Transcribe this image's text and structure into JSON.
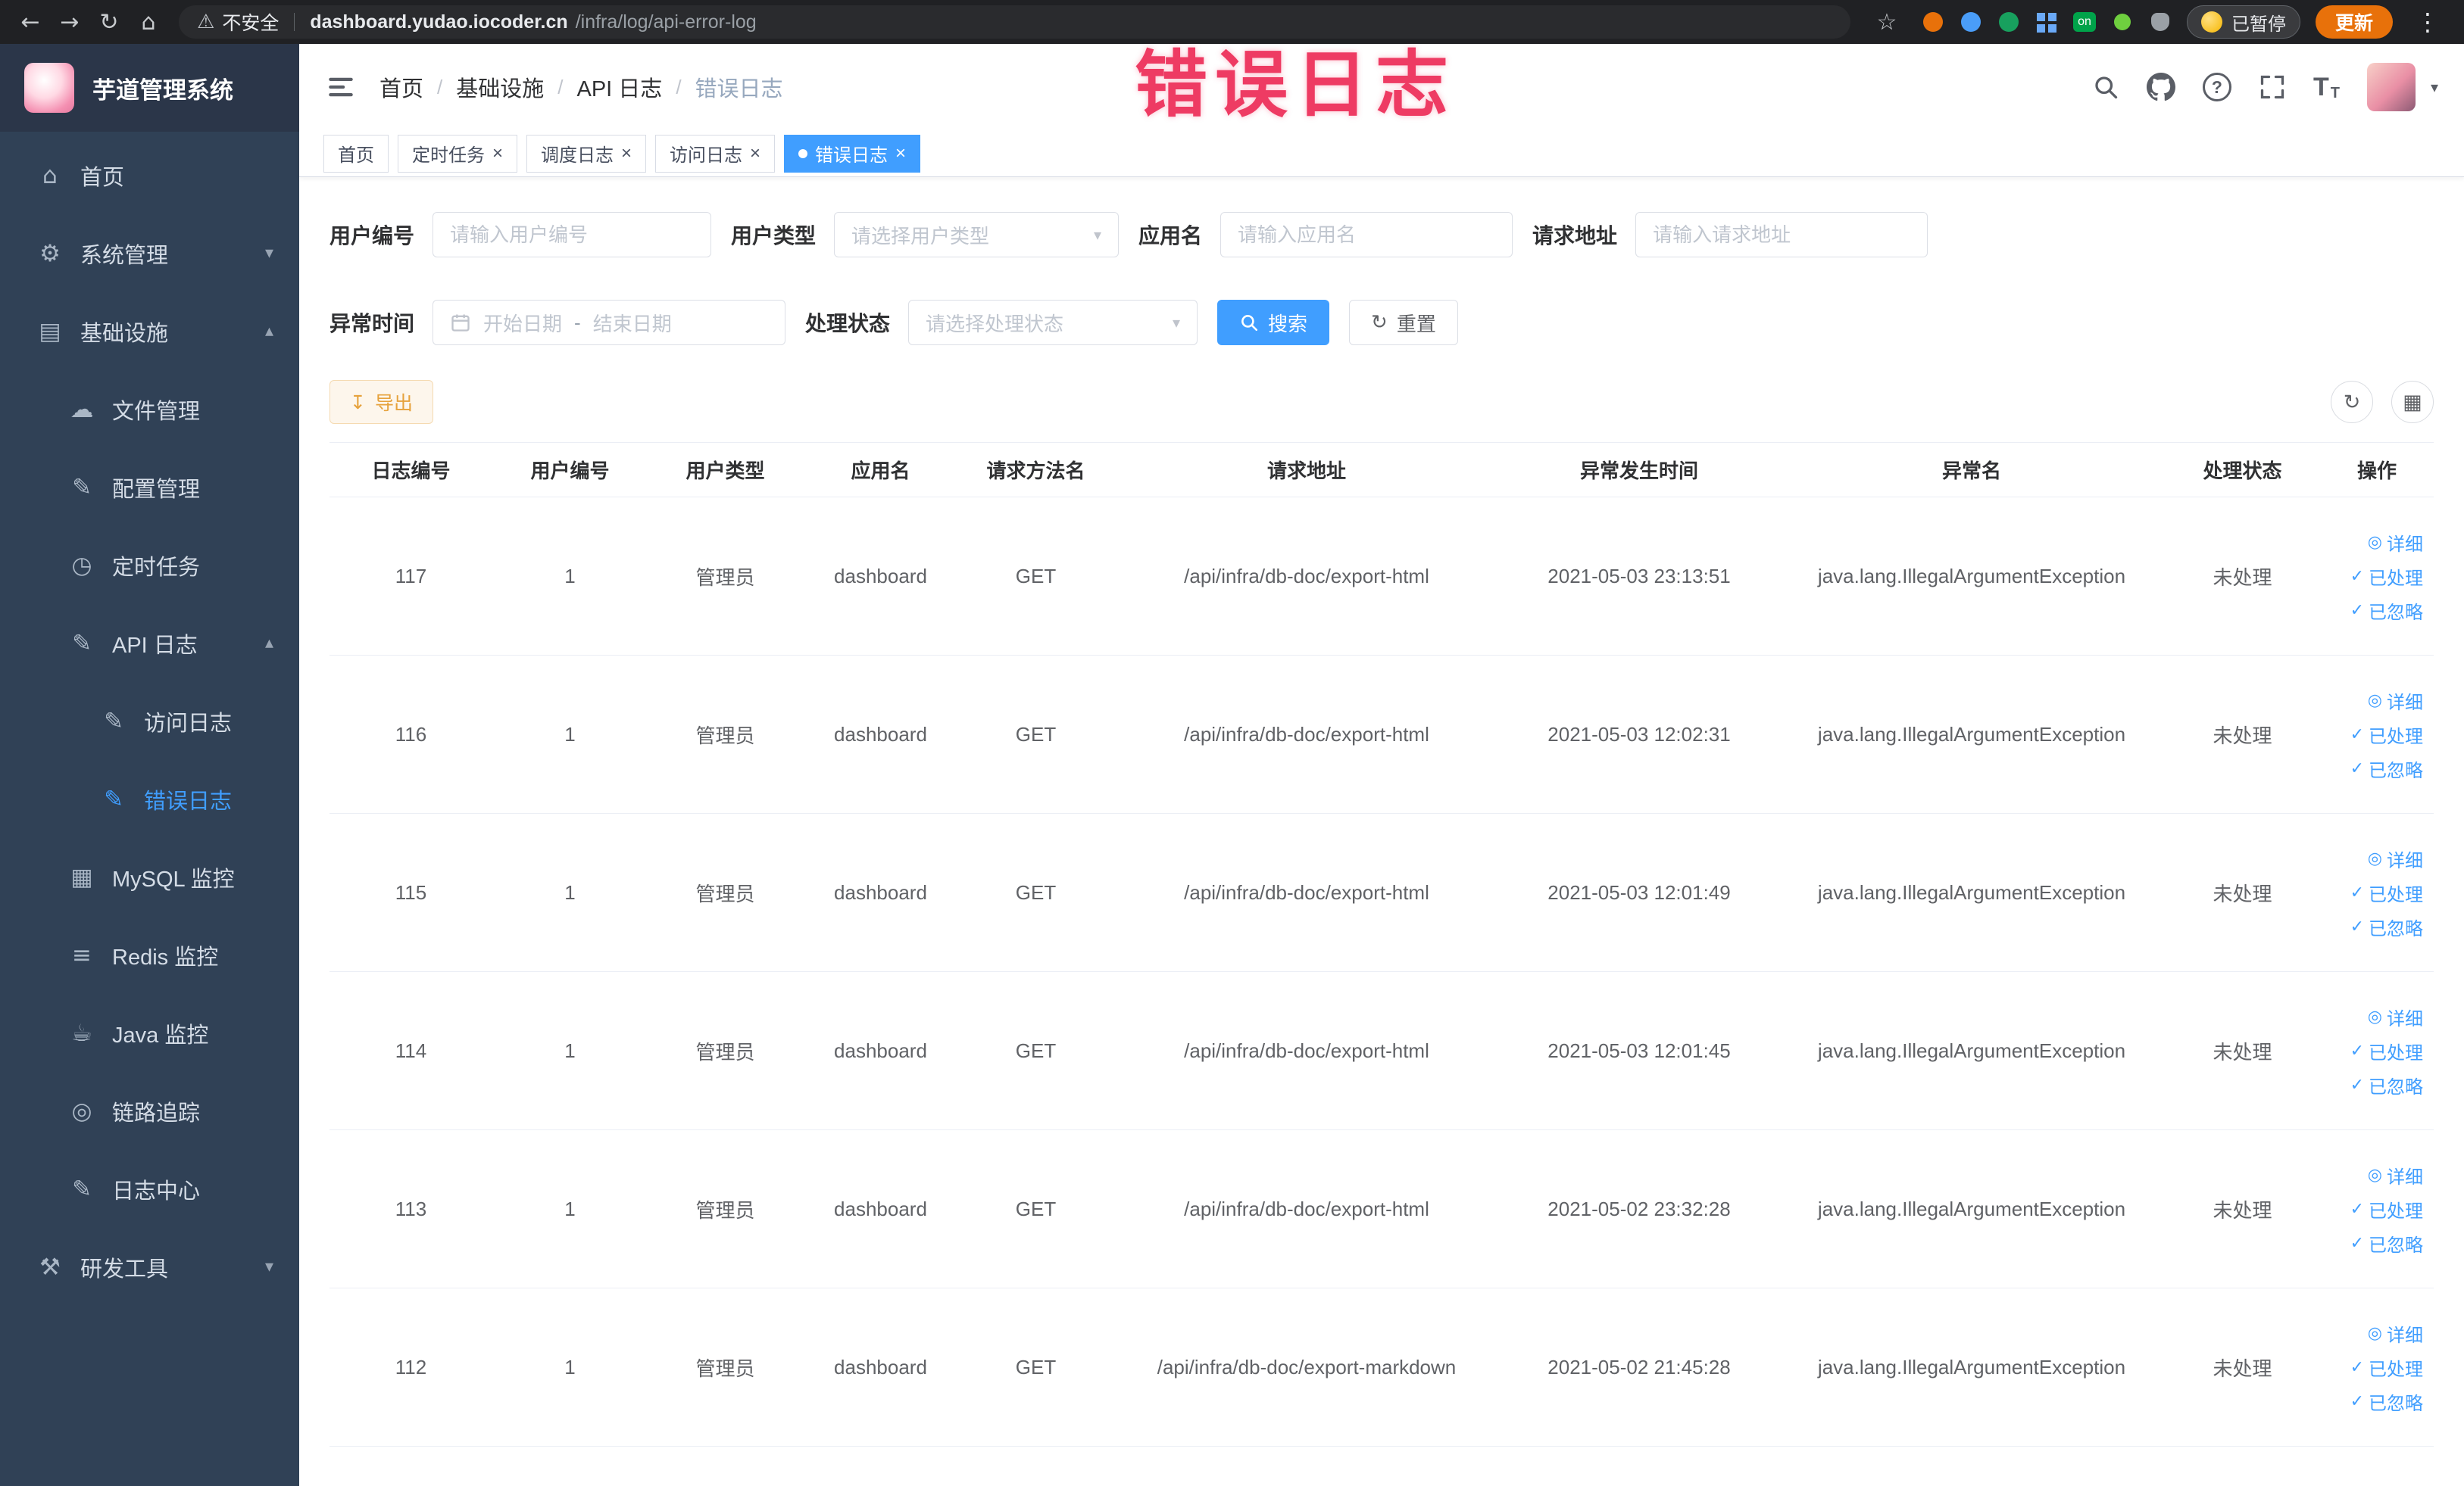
{
  "browser": {
    "security_label": "不安全",
    "url_host": "dashboard.yudao.iocoder.cn",
    "url_path": "/infra/log/api-error-log",
    "paused_label": "已暂停",
    "update_label": "更新"
  },
  "annotation": {
    "text": "错误日志"
  },
  "sidebar": {
    "logo_title": "芋道管理系统",
    "items": [
      {
        "icon": "home",
        "label": "首页",
        "level": 0
      },
      {
        "icon": "gear",
        "label": "系统管理",
        "level": 0,
        "chevron": "down"
      },
      {
        "icon": "monitor",
        "label": "基础设施",
        "level": 0,
        "chevron": "up"
      },
      {
        "icon": "cloud",
        "label": "文件管理",
        "level": 1
      },
      {
        "icon": "edit",
        "label": "配置管理",
        "level": 1
      },
      {
        "icon": "timer",
        "label": "定时任务",
        "level": 1
      },
      {
        "icon": "doc",
        "label": "API 日志",
        "level": 1,
        "chevron": "up"
      },
      {
        "icon": "doc",
        "label": "访问日志",
        "level": 2
      },
      {
        "icon": "doc",
        "label": "错误日志",
        "level": 2,
        "active": true
      },
      {
        "icon": "db",
        "label": "MySQL 监控",
        "level": 1
      },
      {
        "icon": "redis",
        "label": "Redis 监控",
        "level": 1
      },
      {
        "icon": "java",
        "label": "Java 监控",
        "level": 1
      },
      {
        "icon": "trace",
        "label": "链路追踪",
        "level": 1
      },
      {
        "icon": "log",
        "label": "日志中心",
        "level": 1
      },
      {
        "icon": "tools",
        "label": "研发工具",
        "level": 0,
        "chevron": "down"
      }
    ]
  },
  "breadcrumb": {
    "items": [
      {
        "label": "首页",
        "sep": "/"
      },
      {
        "label": "基础设施",
        "sep": "/"
      },
      {
        "label": "API 日志",
        "sep": "/"
      },
      {
        "label": "错误日志",
        "last": true
      }
    ]
  },
  "tabs": [
    {
      "label": "首页"
    },
    {
      "label": "定时任务",
      "closable": true
    },
    {
      "label": "调度日志",
      "closable": true
    },
    {
      "label": "访问日志",
      "closable": true
    },
    {
      "label": "错误日志",
      "closable": true,
      "active": true,
      "dot": true
    }
  ],
  "filters": {
    "user_id": {
      "label": "用户编号",
      "placeholder": "请输入用户编号"
    },
    "user_type": {
      "label": "用户类型",
      "placeholder": "请选择用户类型"
    },
    "app_name": {
      "label": "应用名",
      "placeholder": "请输入应用名"
    },
    "request_url": {
      "label": "请求地址",
      "placeholder": "请输入请求地址"
    },
    "exception_time": {
      "label": "异常时间",
      "start_placeholder": "开始日期",
      "separator": "-",
      "end_placeholder": "结束日期"
    },
    "process_status": {
      "label": "处理状态",
      "placeholder": "请选择处理状态"
    },
    "search_label": "搜索",
    "reset_label": "重置"
  },
  "toolbar": {
    "export_label": "导出"
  },
  "table": {
    "columns": [
      "日志编号",
      "用户编号",
      "用户类型",
      "应用名",
      "请求方法名",
      "请求地址",
      "异常发生时间",
      "异常名",
      "处理状态",
      "操作"
    ],
    "action_labels": {
      "detail": "详细",
      "processed": "已处理",
      "ignored": "已忽略"
    },
    "rows": [
      {
        "id": "117",
        "user_id": "1",
        "user_type": "管理员",
        "app": "dashboard",
        "method": "GET",
        "url": "/api/infra/db-doc/export-html",
        "time": "2021-05-03 23:13:51",
        "exception": "java.lang.IllegalArgumentException",
        "status": "未处理"
      },
      {
        "id": "116",
        "user_id": "1",
        "user_type": "管理员",
        "app": "dashboard",
        "method": "GET",
        "url": "/api/infra/db-doc/export-html",
        "time": "2021-05-03 12:02:31",
        "exception": "java.lang.IllegalArgumentException",
        "status": "未处理"
      },
      {
        "id": "115",
        "user_id": "1",
        "user_type": "管理员",
        "app": "dashboard",
        "method": "GET",
        "url": "/api/infra/db-doc/export-html",
        "time": "2021-05-03 12:01:49",
        "exception": "java.lang.IllegalArgumentException",
        "status": "未处理"
      },
      {
        "id": "114",
        "user_id": "1",
        "user_type": "管理员",
        "app": "dashboard",
        "method": "GET",
        "url": "/api/infra/db-doc/export-html",
        "time": "2021-05-03 12:01:45",
        "exception": "java.lang.IllegalArgumentException",
        "status": "未处理"
      },
      {
        "id": "113",
        "user_id": "1",
        "user_type": "管理员",
        "app": "dashboard",
        "method": "GET",
        "url": "/api/infra/db-doc/export-html",
        "time": "2021-05-02 23:32:28",
        "exception": "java.lang.IllegalArgumentException",
        "status": "未处理"
      },
      {
        "id": "112",
        "user_id": "1",
        "user_type": "管理员",
        "app": "dashboard",
        "method": "GET",
        "url": "/api/infra/db-doc/export-markdown",
        "time": "2021-05-02 21:45:28",
        "exception": "java.lang.IllegalArgumentException",
        "status": "未处理"
      }
    ]
  }
}
